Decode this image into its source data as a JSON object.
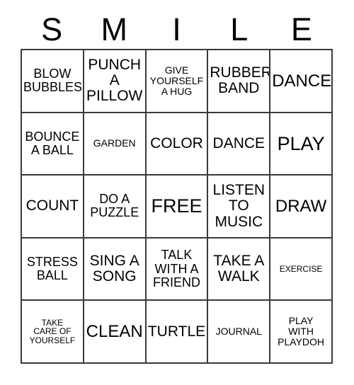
{
  "card": {
    "title_letters": [
      "S",
      "M",
      "I",
      "L",
      "E"
    ],
    "columns": 5,
    "rows": 5,
    "border_color": "#3a3a3a",
    "background_color": "#ffffff",
    "text_color": "#000000",
    "cells": [
      {
        "text": "BLOW\nBUBBLES",
        "size": "md"
      },
      {
        "text": "PUNCH\nA\nPILLOW",
        "size": "lg"
      },
      {
        "text": "GIVE\nYOURSELF\nA HUG",
        "size": "sm"
      },
      {
        "text": "RUBBER\nBAND",
        "size": "lg"
      },
      {
        "text": "DANCE",
        "size": "xl"
      },
      {
        "text": "BOUNCE\nA BALL",
        "size": "md"
      },
      {
        "text": "GARDEN",
        "size": "sm"
      },
      {
        "text": "COLOR",
        "size": "lg"
      },
      {
        "text": "DANCE",
        "size": "lg"
      },
      {
        "text": "PLAY",
        "size": "xxl"
      },
      {
        "text": "COUNT",
        "size": "lg"
      },
      {
        "text": "DO A\nPUZZLE",
        "size": "md"
      },
      {
        "text": "FREE",
        "size": "xxl"
      },
      {
        "text": "LISTEN\nTO\nMUSIC",
        "size": "lg"
      },
      {
        "text": "DRAW",
        "size": "xl"
      },
      {
        "text": "STRESS\nBALL",
        "size": "md"
      },
      {
        "text": "SING A\nSONG",
        "size": "lg"
      },
      {
        "text": "TALK\nWITH A\nFRIEND",
        "size": "md"
      },
      {
        "text": "TAKE A\nWALK",
        "size": "lg"
      },
      {
        "text": "EXERCISE",
        "size": "xs"
      },
      {
        "text": "TAKE\nCARE OF\nYOURSELF",
        "size": "xs"
      },
      {
        "text": "CLEAN",
        "size": "xl"
      },
      {
        "text": "TURTLE",
        "size": "lg"
      },
      {
        "text": "JOURNAL",
        "size": "sm"
      },
      {
        "text": "PLAY\nWITH\nPLAYDOH",
        "size": "sm"
      }
    ]
  }
}
